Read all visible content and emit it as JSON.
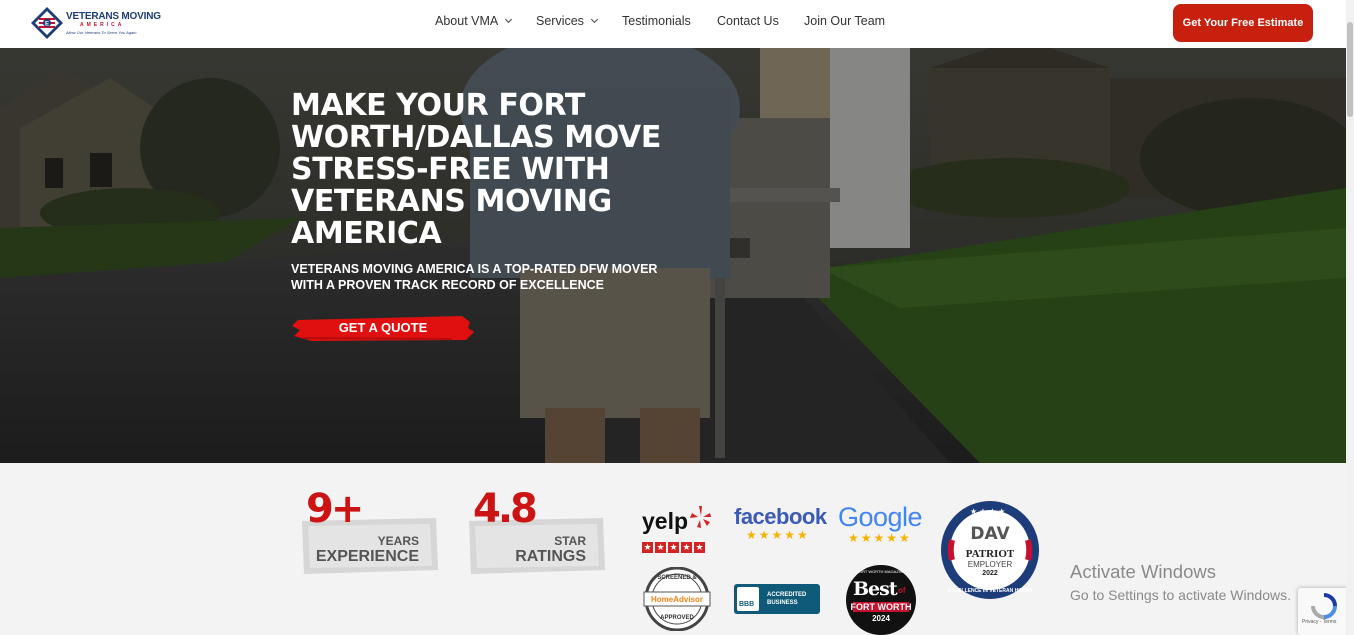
{
  "header": {
    "logo": {
      "name": "VETERANS MOVING",
      "sub": "AMERICA",
      "tagline": "Allow Our Veterans To Serve You Again"
    },
    "nav": [
      {
        "label": "About VMA",
        "has_dropdown": true
      },
      {
        "label": "Services",
        "has_dropdown": true
      },
      {
        "label": "Testimonials",
        "has_dropdown": false
      },
      {
        "label": "Contact Us",
        "has_dropdown": false
      },
      {
        "label": "Join Our Team",
        "has_dropdown": false
      }
    ],
    "cta_label": "Get Your Free Estimate"
  },
  "hero": {
    "title": "MAKE YOUR FORT WORTH/DALLAS MOVE STRESS-FREE WITH VETERANS MOVING AMERICA",
    "subtitle": "VETERANS MOVING AMERICA IS A TOP-RATED DFW MOVER WITH A PROVEN TRACK RECORD OF EXCELLENCE",
    "button_label": "GET A QUOTE"
  },
  "stats": [
    {
      "number": "9+",
      "small": "YEARS",
      "big": "EXPERIENCE"
    },
    {
      "number": "4.8",
      "small": "STAR",
      "big": "RATINGS"
    }
  ],
  "badges": {
    "yelp": {
      "name": "yelp",
      "rating": 5
    },
    "facebook": {
      "name": "facebook",
      "rating": 5
    },
    "google": {
      "name": "Google",
      "rating": 5
    },
    "dav": {
      "name": "DAV",
      "line1": "PATRIOT",
      "line2": "EMPLOYER",
      "year": "2022",
      "ring": "EXCELLENCE IN VETERAN HIRING"
    },
    "homeadvisor": {
      "top": "SCREENED &",
      "name": "HomeAdvisor",
      "bottom": "APPROVED"
    },
    "bbb": {
      "logo": "BBB",
      "text1": "ACCREDITED",
      "text2": "BUSINESS"
    },
    "best": {
      "top": "FORT WORTH MAGAZINE",
      "word1": "Best",
      "word2": "of",
      "city": "FORT WORTH",
      "year": "2024"
    }
  },
  "system": {
    "activate_title": "Activate Windows",
    "activate_sub": "Go to Settings to activate Windows.",
    "recaptcha": "Privacy - Terms"
  },
  "colors": {
    "brand_red": "#c8200e",
    "brand_blue": "#1d3d7a",
    "stat_red": "#cc1414"
  }
}
